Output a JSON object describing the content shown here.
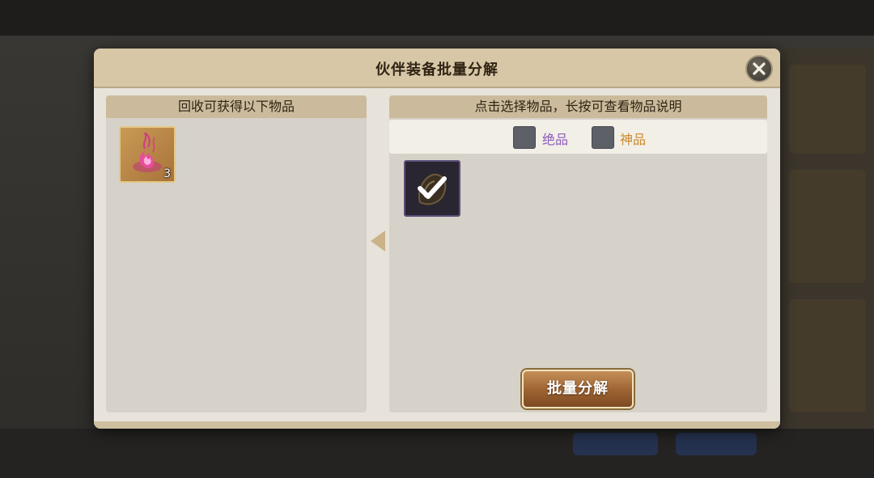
{
  "dialog": {
    "title": "伙伴装备批量分解"
  },
  "left_panel": {
    "header": "回收可获得以下物品",
    "items": [
      {
        "name": "pink-flame-material",
        "count": "3"
      }
    ]
  },
  "right_panel": {
    "header": "点击选择物品，长按可查看物品说明",
    "filters": [
      {
        "label": "绝品",
        "color": "#8a5db8",
        "checked": false
      },
      {
        "label": "神品",
        "color": "#c98a2a",
        "checked": false
      }
    ],
    "items": [
      {
        "name": "dark-equipment",
        "selected": true
      }
    ],
    "action_button": "批量分解"
  },
  "colors": {
    "accent_gold": "#c48f58",
    "header_bg": "#d8c7a6"
  }
}
